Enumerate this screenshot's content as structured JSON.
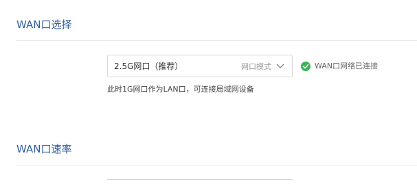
{
  "wan_port_select": {
    "title": "WAN口选择",
    "selected_value": "2.5G网口（推荐）",
    "mode_label": "网口模式",
    "status_text": "WAN口网络已连接",
    "note": "此时1G网口作为LAN口，可连接局域网设备",
    "status_color": "#3cb55a"
  },
  "wan_port_rate": {
    "title": "WAN口速率"
  },
  "colors": {
    "title": "#2f5ea3",
    "divider": "#e6e6e6"
  }
}
